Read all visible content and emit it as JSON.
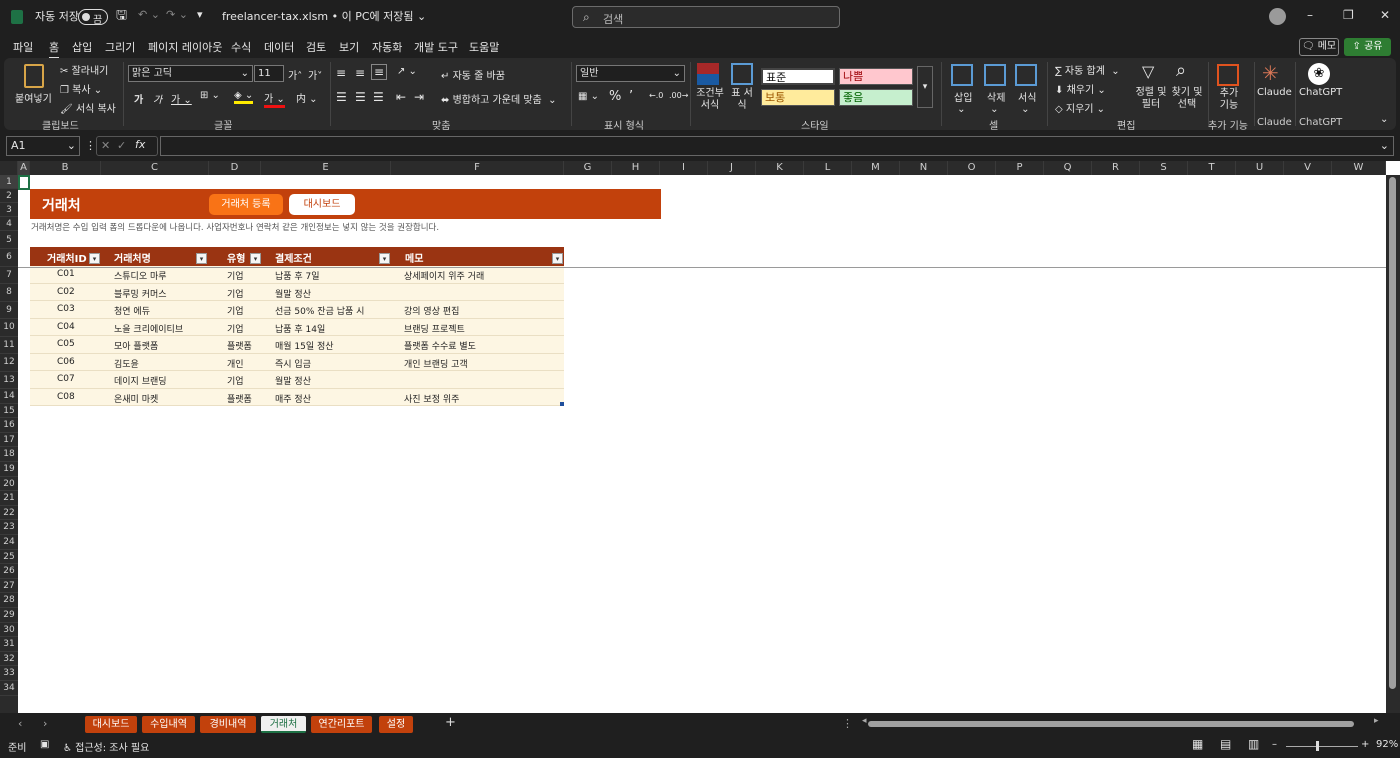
{
  "titlebar": {
    "autosave_label": "자동 저장",
    "autosave_state": "끔",
    "file_title": "freelancer-tax.xlsm • 이 PC에 저장됨",
    "search_placeholder": "검색"
  },
  "menu": [
    "파일",
    "홈",
    "삽입",
    "그리기",
    "페이지 레이아웃",
    "수식",
    "데이터",
    "검토",
    "보기",
    "자동화",
    "개발 도구",
    "도움말"
  ],
  "menu_active": "홈",
  "memo_label": "메모",
  "share_label": "공유",
  "ribbon": {
    "clipboard": {
      "paste": "붙여넣기",
      "cut": "잘라내기",
      "copy": "복사",
      "format_painter": "서식 복사",
      "label": "클립보드"
    },
    "font": {
      "name": "맑은 고딕",
      "size": "11",
      "label": "글꼴"
    },
    "align": {
      "wrap": "자동 줄 바꿈",
      "merge": "병합하고 가운데 맞춤",
      "label": "맞춤"
    },
    "number": {
      "format": "일반",
      "label": "표시 형식"
    },
    "styles": {
      "cond": "조건부 서식",
      "table": "표 서식",
      "normal": "표준",
      "bad": "나쁨",
      "neutral": "보통",
      "good": "좋음",
      "label": "스타일"
    },
    "cells": {
      "insert": "삽입",
      "delete": "삭제",
      "format": "서식",
      "label": "셀"
    },
    "editing": {
      "autosum": "자동 합계",
      "fill": "채우기",
      "clear": "지우기",
      "sort": "정렬 및 필터",
      "find": "찾기 및 선택",
      "label": "편집"
    },
    "addins": {
      "label": "추가 기능",
      "btn": "추가 기능"
    },
    "claude": {
      "label": "Claude",
      "btn": "Claude"
    },
    "chatgpt": {
      "label": "ChatGPT",
      "btn": "ChatGPT"
    }
  },
  "namebox": "A1",
  "columns": [
    "A",
    "B",
    "C",
    "D",
    "E",
    "F",
    "G",
    "H",
    "I",
    "J",
    "K",
    "L",
    "M",
    "N",
    "O",
    "P",
    "Q",
    "R",
    "S",
    "T",
    "U",
    "V",
    "W"
  ],
  "rows": [
    "1",
    "2",
    "3",
    "4",
    "5",
    "6",
    "7",
    "8",
    "9",
    "10",
    "11",
    "12",
    "13",
    "14",
    "15",
    "16",
    "17",
    "18",
    "19",
    "20",
    "21",
    "22",
    "23",
    "24",
    "25",
    "26",
    "27",
    "28",
    "29",
    "30",
    "31",
    "32",
    "33",
    "34"
  ],
  "sheet": {
    "title": "거래처",
    "btn_register": "거래처 등록",
    "btn_dashboard": "대시보드",
    "note": "거래처명은 수입 입력 폼의 드롭다운에 나옵니다. 사업자번호나 연락처 같은 개인정보는 넣지 않는 것을 권장합니다.",
    "headers": [
      "거래처ID",
      "거래처명",
      "유형",
      "결제조건",
      "메모"
    ],
    "rows": [
      [
        "C01",
        "스튜디오 마루",
        "기업",
        "납품 후 7일",
        "상세페이지 위주 거래"
      ],
      [
        "C02",
        "블루밍 커머스",
        "기업",
        "월말 정산",
        ""
      ],
      [
        "C03",
        "청연 에듀",
        "기업",
        "선금 50% 잔금 납품 시",
        "강의 영상 편집"
      ],
      [
        "C04",
        "노을 크리에이티브",
        "기업",
        "납품 후 14일",
        "브랜딩 프로젝트"
      ],
      [
        "C05",
        "모아 플랫폼",
        "플랫폼",
        "매월 15일 정산",
        "플랫폼 수수료 별도"
      ],
      [
        "C06",
        "김도윤",
        "개인",
        "즉시 입금",
        "개인 브랜딩 고객"
      ],
      [
        "C07",
        "데이지 브랜딩",
        "기업",
        "월말 정산",
        ""
      ],
      [
        "C08",
        "온새미 마켓",
        "플랫폼",
        "매주 정산",
        "사진 보정 위주"
      ]
    ]
  },
  "tabs": [
    "대시보드",
    "수입내역",
    "경비내역",
    "거래처",
    "연간리포트",
    "설정"
  ],
  "active_tab": "거래처",
  "status": {
    "ready": "준비",
    "accessibility": "접근성: 조사 필요",
    "zoom": "92%"
  },
  "colors": {
    "accent": "#c2410c",
    "header": "#9a3412",
    "row_bg": "#fdf6e3",
    "excel_green": "#1e7145"
  }
}
